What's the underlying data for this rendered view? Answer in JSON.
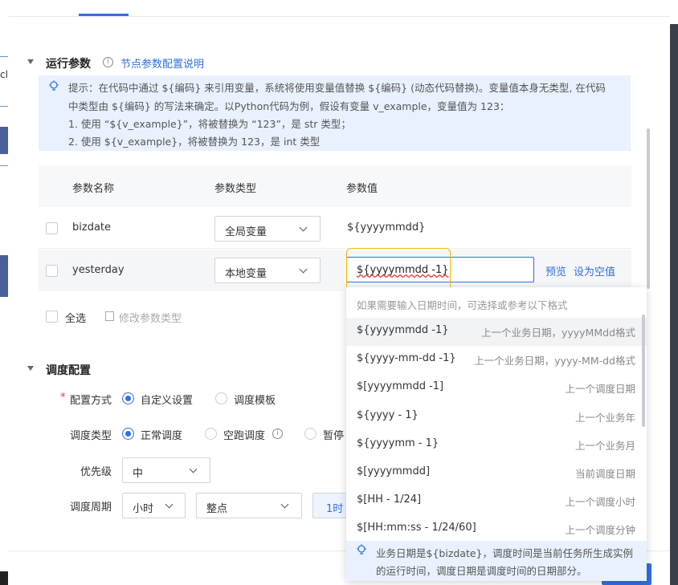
{
  "section_run": {
    "title": "运行参数",
    "help_link": "节点参数配置说明",
    "tip": {
      "line1": "提示：在代码中通过 ${编码} 来引用变量，系统将使用变量值替换 ${编码} (动态代码替换)。变量值本身无类型, 在代码",
      "line2": "中类型由 ${编码} 的写法来确定。以Python代码为例，假设有变量 v_example，变量值为 123：",
      "line3": "1. 使用 “${v_example}”，将被替换为 “123”，是 str 类型；",
      "line4": "2. 使用 ${v_example}，将被替换为 123，是 int 类型"
    },
    "table": {
      "headers": [
        "参数名称",
        "参数类型",
        "参数值"
      ],
      "rows": [
        {
          "name": "bizdate",
          "type": "全局变量",
          "value": "${yyyymmdd}"
        },
        {
          "name": "yesterday",
          "type": "本地变量",
          "value": "${yyyymmdd -1}"
        }
      ],
      "preview": "预览",
      "set_empty": "设为空值",
      "select_all": "全选",
      "modify_type": "修改参数类型"
    }
  },
  "dropdown": {
    "hint": "如果需要输入日期时间，可选择或参考以下格式",
    "items": [
      {
        "value": "${yyyymmdd -1}",
        "desc": "上一个业务日期，yyyyMMdd格式"
      },
      {
        "value": "${yyyy-mm-dd -1}",
        "desc": "上一个业务日期，yyyy-MM-dd格式"
      },
      {
        "value": "$[yyyymmdd -1]",
        "desc": "上一个调度日期"
      },
      {
        "value": "${yyyy - 1}",
        "desc": "上一个业务年"
      },
      {
        "value": "${yyyymm - 1}",
        "desc": "上一个业务月"
      },
      {
        "value": "$[yyyymmdd]",
        "desc": "当前调度日期"
      },
      {
        "value": "$[HH - 1/24]",
        "desc": "上一个调度小时"
      },
      {
        "value": "$[HH:mm:ss - 1/24/60]",
        "desc": "上一个调度分钟"
      }
    ],
    "footer_line1": "业务日期是${bizdate}，调度时间是当前任务所生成实例",
    "footer_line2": "的运行时间，调度日期是调度时间的日期部分。"
  },
  "section_schedule": {
    "title": "调度配置",
    "config_mode_label": "配置方式",
    "config_mode_options": [
      "自定义设置",
      "调度模板"
    ],
    "schedule_type_label": "调度类型",
    "schedule_type_options": [
      "正常调度",
      "空跑调度",
      "暂停"
    ],
    "priority_label": "优先级",
    "priority_value": "中",
    "cycle_label": "调度周期",
    "cycle_value": "小时",
    "cycle_point": "整点",
    "cycle_interval": "1时"
  },
  "left_edge": {
    "fragment": "cl"
  },
  "colors": {
    "accent": "#2f6fe0",
    "highlight": "#f5b700",
    "tip_bg": "#e8f1fd"
  }
}
